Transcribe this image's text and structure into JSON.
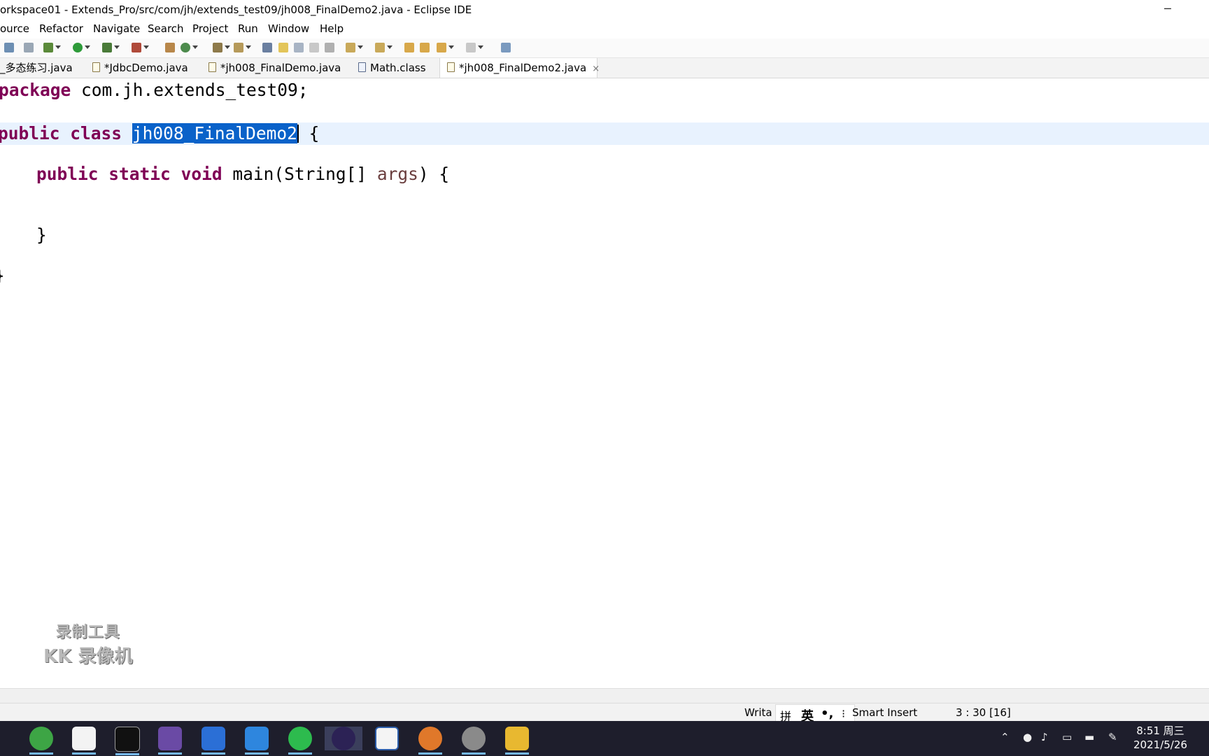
{
  "window": {
    "title": "orkspace01 - Extends_Pro/src/com/jh/extends_test09/jh008_FinalDemo2.java - Eclipse IDE",
    "minimize": "─"
  },
  "menu": [
    "ource",
    "Refactor",
    "Navigate",
    "Search",
    "Project",
    "Run",
    "Window",
    "Help"
  ],
  "tabs": [
    {
      "label": "_多态练习.java",
      "icon": "java-file-icon"
    },
    {
      "label": "*JdbcDemo.java",
      "icon": "java-file-icon"
    },
    {
      "label": "*jh008_FinalDemo.java",
      "icon": "java-file-icon"
    },
    {
      "label": "Math.class",
      "icon": "class-file-icon"
    },
    {
      "label": "*jh008_FinalDemo2.java",
      "icon": "java-file-icon",
      "active": true,
      "close": "×"
    }
  ],
  "code": {
    "kw_package": "package",
    "package_name": " com.jh.extends_test09;",
    "kw_public": "public",
    "kw_class": "class",
    "class_name": "jh008_FinalDemo2",
    "open_brace": " {",
    "kw_static": "static",
    "kw_void": "void",
    "main_sig": " main(String[] ",
    "param": "args",
    "main_tail": ") {",
    "close_brace": "}"
  },
  "watermark": {
    "line1": "录制工具",
    "line2": "KK 录像机"
  },
  "status": {
    "writable": "Writa",
    "ime_pin": "拼",
    "ime_ying": "英",
    "ime_punct": "•,",
    "ime_more": "⁝",
    "insert_mode": "Smart Insert",
    "position": "3 : 30 [16]"
  },
  "taskbar": {
    "apps": [
      "browser-icon",
      "notes-icon",
      "terminal-icon",
      "dolphin-icon",
      "wps-writer-icon",
      "contacts-icon",
      "wechat-icon",
      "eclipse-icon",
      "vscode-icon",
      "bandicam-icon",
      "steam-icon",
      "file-explorer-icon"
    ],
    "time": "8:51 周三",
    "date": "2021/5/26"
  },
  "colors": {
    "keyword": "#7f0055",
    "selection": "#0a62c9",
    "current_line": "#e8f2fe",
    "param": "#6a3e3e",
    "taskbar": "#1e1e2c"
  }
}
